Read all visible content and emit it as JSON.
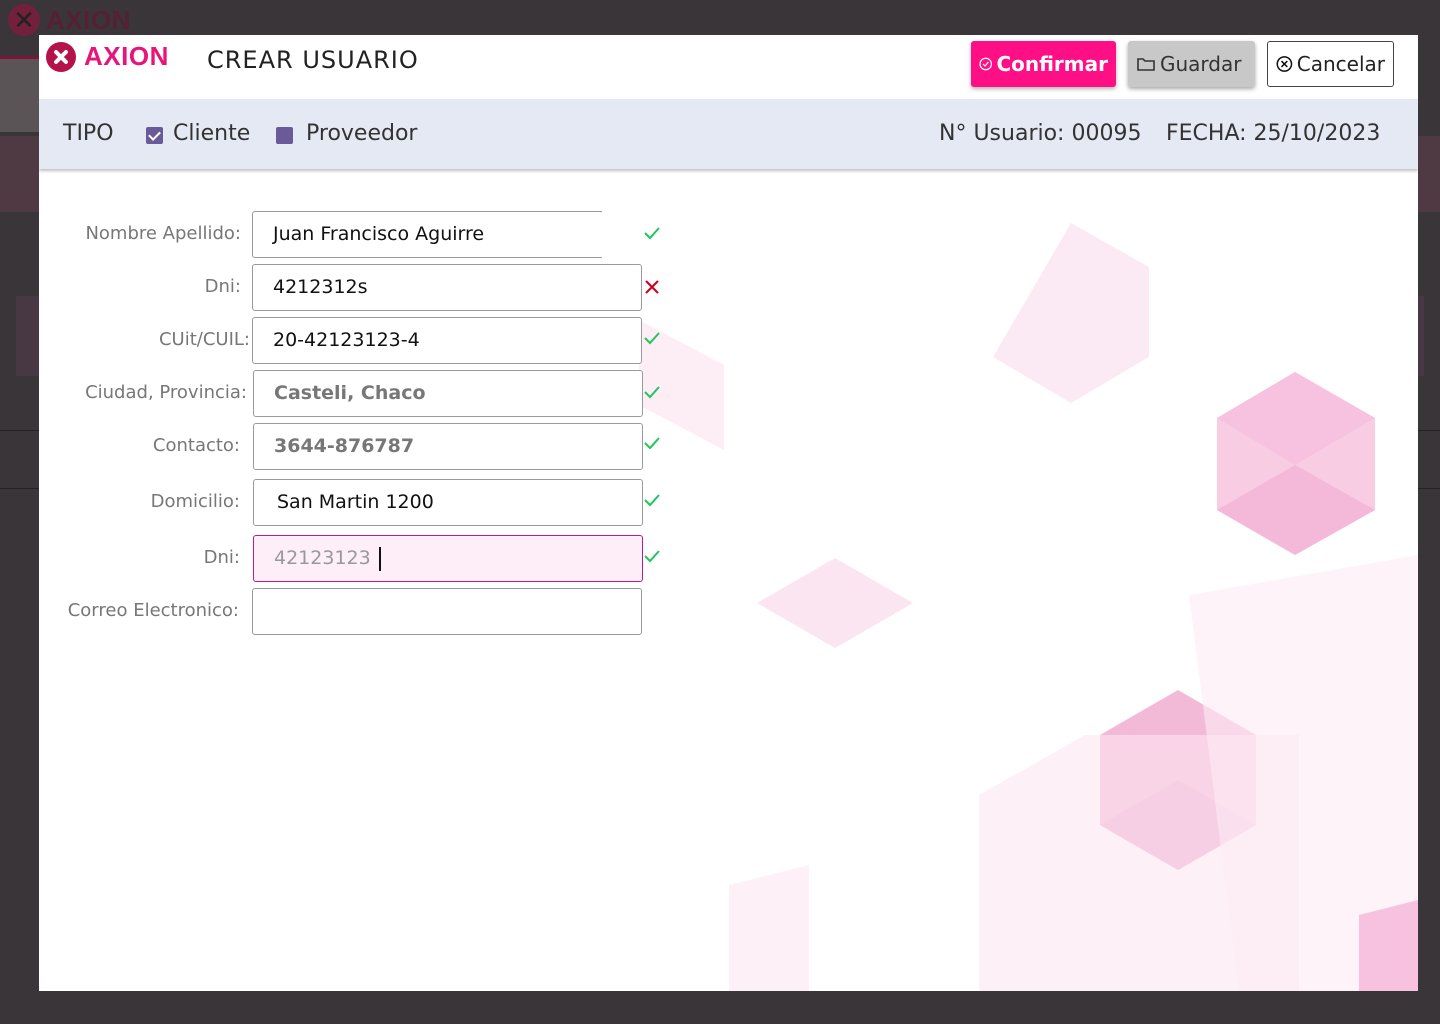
{
  "background": {
    "logo_text": "AXION"
  },
  "header": {
    "logo_text": "AXION",
    "title": "CREAR USUARIO",
    "confirm_label": "Confirmar",
    "save_label": "Guardar",
    "cancel_label": "Cancelar"
  },
  "type_bar": {
    "label": "TIPO",
    "options": [
      {
        "label": "Cliente",
        "checked": true
      },
      {
        "label": "Proveedor",
        "checked": false
      }
    ],
    "user_number": "N° Usuario: 00095",
    "date": "FECHA: 25/10/2023"
  },
  "form": {
    "fields": [
      {
        "label": "Nombre Apellido:",
        "value": "Juan Francisco Aguirre",
        "status": "valid"
      },
      {
        "label": "Dni:",
        "value": "4212312s",
        "status": "invalid"
      },
      {
        "label": "CUit/CUIL:",
        "value": "20-42123123-4",
        "status": "valid"
      },
      {
        "label": "Ciudad, Provincia:",
        "value": "Casteli, Chaco",
        "status": "valid"
      },
      {
        "label": "Contacto:",
        "value": "3644-876787",
        "status": "valid"
      },
      {
        "label": "Domicilio:",
        "value": "San Martin 1200",
        "status": "valid"
      },
      {
        "label": "Dni:",
        "value": "42123123",
        "status": "valid"
      },
      {
        "label": "Correo Electronico:",
        "value": "",
        "status": "none"
      }
    ]
  },
  "colors": {
    "accent": "#ff0f85",
    "valid": "#22c55e",
    "invalid": "#d0021b",
    "checkbox": "#6a5a9a"
  }
}
